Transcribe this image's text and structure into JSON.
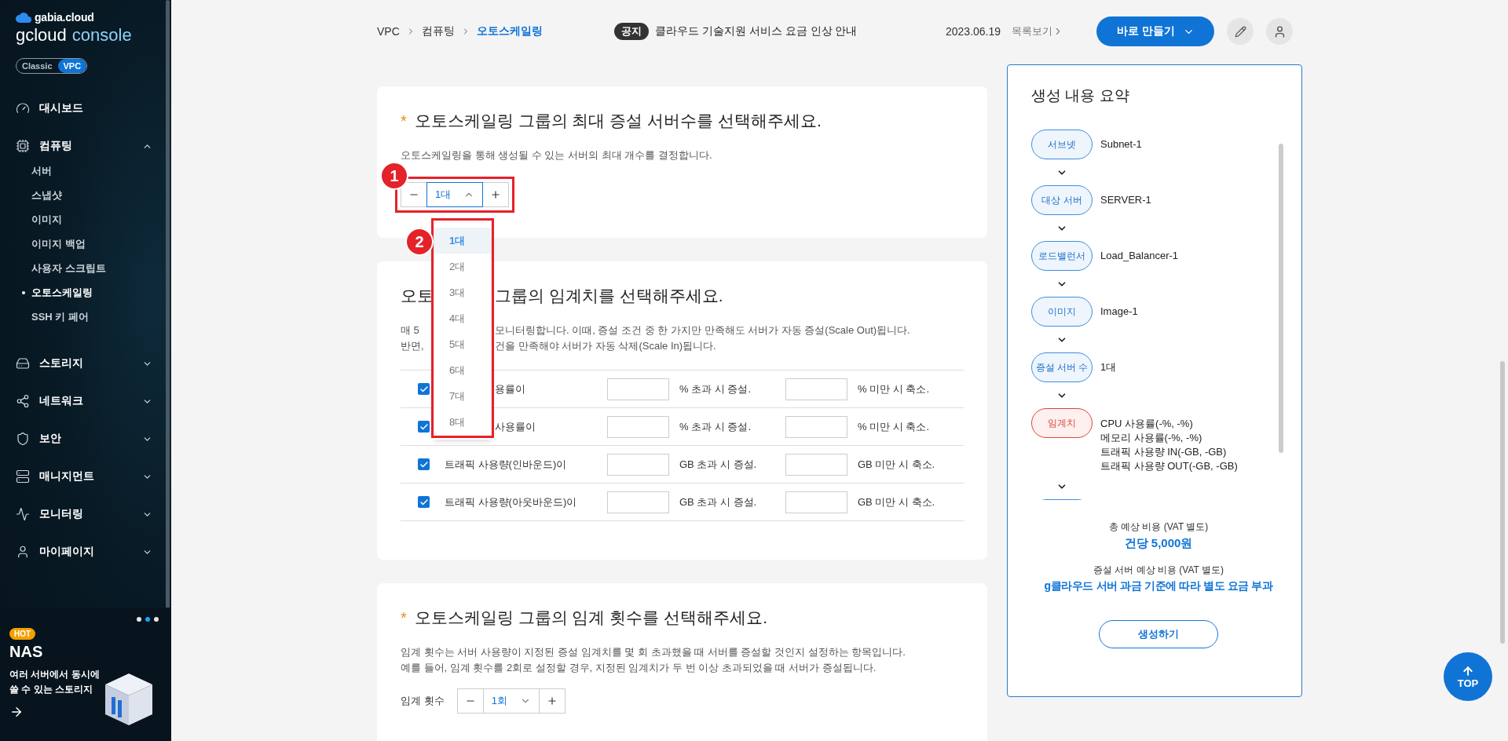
{
  "sidebar": {
    "brand": "gabia.cloud",
    "product": "gcloud",
    "product_suffix": "console",
    "mode_toggle": [
      {
        "label": "Classic",
        "selected": false
      },
      {
        "label": "VPC",
        "selected": true
      }
    ],
    "menu": [
      {
        "label": "대시보드",
        "kind": "link"
      },
      {
        "label": "컴퓨팅",
        "kind": "group",
        "expanded": true,
        "children": [
          {
            "label": "서버",
            "selected": false
          },
          {
            "label": "스냅샷",
            "selected": false
          },
          {
            "label": "이미지",
            "selected": false
          },
          {
            "label": "이미지 백업",
            "selected": false
          },
          {
            "label": "사용자 스크립트",
            "selected": false
          },
          {
            "label": "오토스케일링",
            "selected": true
          },
          {
            "label": "SSH 키 페어",
            "selected": false
          }
        ]
      },
      {
        "label": "스토리지",
        "kind": "group",
        "expanded": false
      },
      {
        "label": "네트워크",
        "kind": "group",
        "expanded": false
      },
      {
        "label": "보안",
        "kind": "group",
        "expanded": false
      },
      {
        "label": "매니지먼트",
        "kind": "group",
        "expanded": false
      },
      {
        "label": "모니터링",
        "kind": "group",
        "expanded": false
      },
      {
        "label": "마이페이지",
        "kind": "group",
        "expanded": false
      }
    ],
    "promo": {
      "badge": "HOT",
      "title": "NAS",
      "text": "여러 서버에서 동시에\n쓸 수 있는 스토리지",
      "dots": [
        {
          "selected": false
        },
        {
          "selected": true
        },
        {
          "selected": false
        }
      ]
    }
  },
  "topbar": {
    "breadcrumb": [
      {
        "label": "VPC",
        "selected": false
      },
      {
        "label": "컴퓨팅",
        "selected": false
      },
      {
        "label": "오토스케일링",
        "selected": true
      }
    ],
    "notice": {
      "badge": "공지",
      "text": "클라우드 기술지원 서비스 요금 인상 안내",
      "date": "2023.06.19",
      "more": "목록보기"
    },
    "create_button": "바로 만들기"
  },
  "max_servers": {
    "required_mark": "*",
    "title": "오토스케일링 그룹의 최대 증설 서버수를 선택해주세요.",
    "description": "오토스케일링을 통해 생성될 수 있는 서버의 최대 개수를 결정합니다.",
    "stepper": {
      "value": "1대",
      "open": true
    },
    "dropdown": [
      {
        "label": "1대",
        "selected": true
      },
      {
        "label": "2대",
        "selected": false
      },
      {
        "label": "3대",
        "selected": false
      },
      {
        "label": "4대",
        "selected": false
      },
      {
        "label": "5대",
        "selected": false
      },
      {
        "label": "6대",
        "selected": false
      },
      {
        "label": "7대",
        "selected": false
      },
      {
        "label": "8대",
        "selected": false
      }
    ],
    "callouts": [
      "1",
      "2"
    ]
  },
  "threshold": {
    "title_parts": [
      "오토",
      "그룹의 임계치를 선택해주세요."
    ],
    "description_lines": [
      [
        "매 5",
        "모니터링합니다. 이때, 증설 조건 중 한 가지만 만족해도 서버가 자동 증설(Scale Out)됩니다."
      ],
      [
        "반면,",
        "건을 만족해야 서버가 자동 삭제(Scale In)됩니다."
      ]
    ],
    "rows": [
      {
        "label": "용률이",
        "covered": true,
        "checked": true,
        "increase_text": "% 초과 시 증설.",
        "decrease_text": "% 미만 시 축소."
      },
      {
        "label": "사용률이",
        "covered": true,
        "checked": true,
        "increase_text": "% 초과 시 증설.",
        "decrease_text": "% 미만 시 축소."
      },
      {
        "label": "트래픽 사용량(인바운드)이",
        "covered": false,
        "checked": true,
        "increase_text": "GB 초과 시 증설.",
        "decrease_text": "GB 미만 시 축소."
      },
      {
        "label": "트래픽 사용량(아웃바운드)이",
        "covered": false,
        "checked": true,
        "increase_text": "GB 초과 시 증설.",
        "decrease_text": "GB 미만 시 축소."
      }
    ]
  },
  "threshold_count": {
    "required_mark": "*",
    "title": "오토스케일링 그룹의 임계 횟수를 선택해주세요.",
    "description": "임계 횟수는 서버 사용량이 지정된 증설 임계치를 몇 회 초과했을 때 서버를 증설할 것인지 설정하는 항목입니다.\n예를 들어, 임계 횟수를 2회로 설정할 경우, 지정된 임계치가 두 번 이상 초과되었을 때 서버가 증설됩니다.",
    "field_label": "임계 횟수",
    "stepper": {
      "value": "1회",
      "open": false
    }
  },
  "summary": {
    "title": "생성 내용 요약",
    "steps": [
      {
        "label": "서브넷",
        "value": "Subnet-1",
        "kind": "normal"
      },
      {
        "label": "대상 서버",
        "value": "SERVER-1",
        "kind": "normal"
      },
      {
        "label": "로드밸런서",
        "value": "Load_Balancer-1",
        "kind": "normal"
      },
      {
        "label": "이미지",
        "value": "Image-1",
        "kind": "normal"
      },
      {
        "label": "증설 서버 수",
        "value": "1대",
        "kind": "normal"
      },
      {
        "label": "임계치",
        "value": "CPU 사용률(-%, -%)\n메모리 사용률(-%, -%)\n트래픽 사용량 IN(-GB, -GB)\n트래픽 사용량 OUT(-GB, -GB)",
        "kind": "alert"
      }
    ],
    "total_label": "총 예상 비용 (VAT 별도)",
    "total_value": "건당 5,000원",
    "extra_label": "증설 서버 예상 비용 (VAT 별도)",
    "extra_value": "g클라우드 서버 과금 기준에 따라 별도 요금 부과",
    "submit": "생성하기"
  },
  "top_button": "TOP"
}
